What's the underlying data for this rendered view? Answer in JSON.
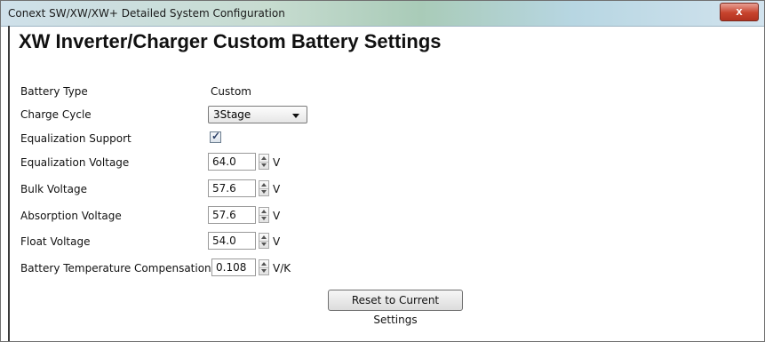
{
  "window": {
    "title": "Conext SW/XW/XW+ Detailed System Configuration",
    "close_label": "x"
  },
  "heading": "XW Inverter/Charger Custom Battery Settings",
  "fields": {
    "battery_type": {
      "label": "Battery Type",
      "value": "Custom"
    },
    "charge_cycle": {
      "label": "Charge Cycle",
      "value": "3Stage"
    },
    "equalization_support": {
      "label": "Equalization Support",
      "checked": true
    },
    "equalization_voltage": {
      "label": "Equalization Voltage",
      "value": "64.0",
      "unit": "V"
    },
    "bulk_voltage": {
      "label": "Bulk Voltage",
      "value": "57.6",
      "unit": "V"
    },
    "absorption_voltage": {
      "label": "Absorption Voltage",
      "value": "57.6",
      "unit": "V"
    },
    "float_voltage": {
      "label": "Float Voltage",
      "value": "54.0",
      "unit": "V"
    },
    "battery_temp_compensation": {
      "label": "Battery Temperature Compensation",
      "value": "0.108",
      "unit": "V/K"
    }
  },
  "buttons": {
    "reset_label": "Reset to Current Settings"
  },
  "icons": {
    "close": "close-icon",
    "dropdown": "chevron-down-icon",
    "spin_up": "spin-up-icon",
    "spin_down": "spin-down-icon",
    "check": "checkmark-icon"
  },
  "colors": {
    "close_button": "#c7432d",
    "titlebar": "#b7d6e2"
  }
}
